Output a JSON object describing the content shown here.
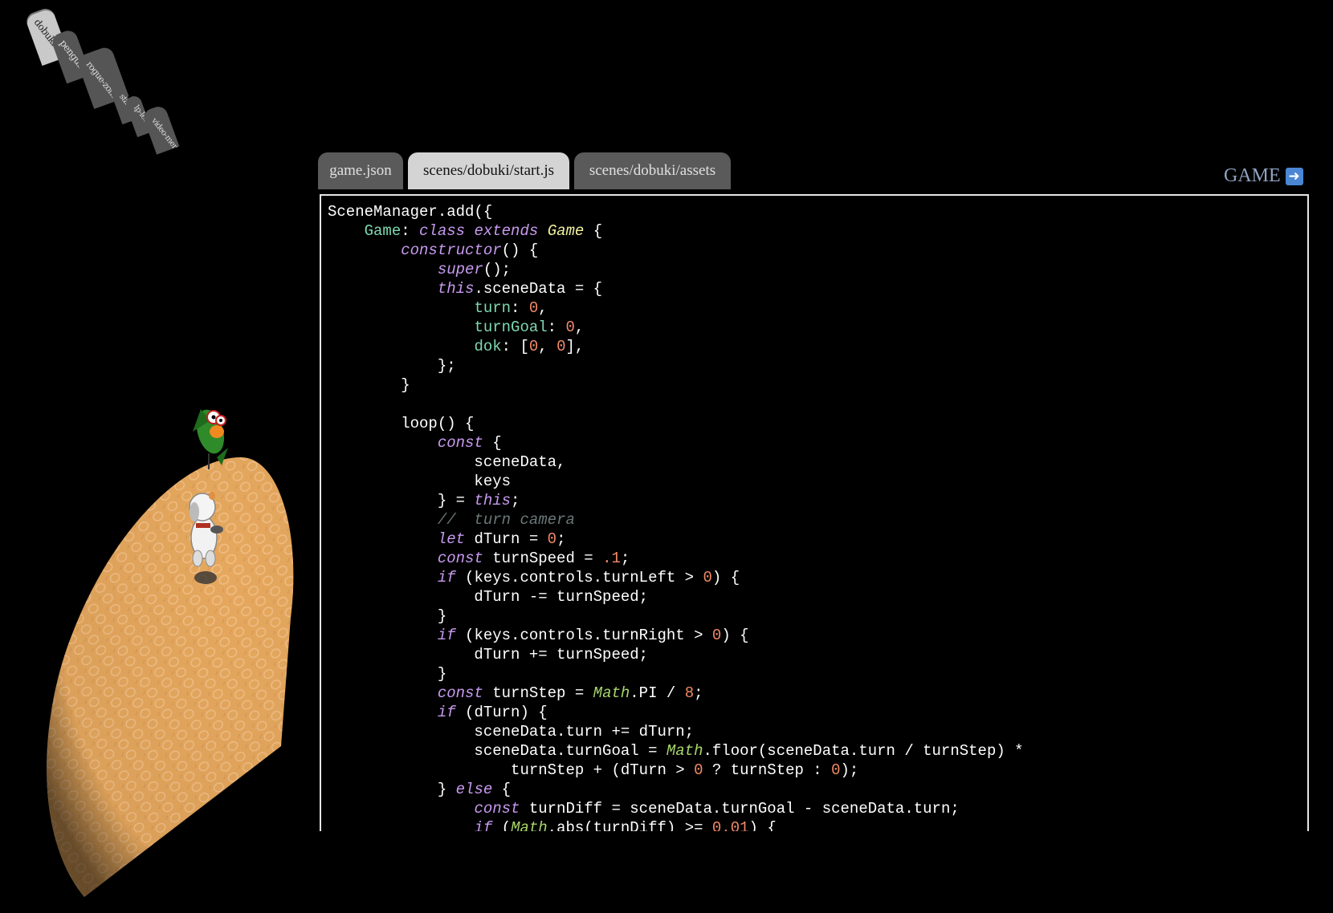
{
  "scene_tabs": [
    {
      "label": "dobuki",
      "active": true
    },
    {
      "label": "penguin",
      "active": false
    },
    {
      "label": "rogue-zombie",
      "active": false
    },
    {
      "label": "start",
      "active": false
    },
    {
      "label": "lp-lets",
      "active": false
    },
    {
      "label": "video-menu",
      "active": false
    }
  ],
  "file_tabs": [
    {
      "label": "game.json",
      "active": false
    },
    {
      "label": "scenes/dobuki/start.js",
      "active": true
    },
    {
      "label": "scenes/dobuki/assets",
      "active": false
    }
  ],
  "game_button": {
    "label": "GAME",
    "icon": "right-arrow-icon"
  },
  "colors": {
    "background": "#000000",
    "keyword": "#c89af0",
    "number": "#f08a68",
    "property": "#7ed8b0",
    "comment": "#6b7878",
    "math": "#a8d66a",
    "game_link": "#8fa3c0",
    "floor": "#e5a860"
  },
  "code_lines": [
    [
      [
        "pl",
        "SceneManager.add({"
      ]
    ],
    [
      [
        "pl",
        "    "
      ],
      [
        "prop",
        "Game"
      ],
      [
        "pl",
        ": "
      ],
      [
        "kw",
        "class"
      ],
      [
        "pl",
        " "
      ],
      [
        "kw",
        "extends"
      ],
      [
        "pl",
        " "
      ],
      [
        "game",
        "Game"
      ],
      [
        "pl",
        " {"
      ]
    ],
    [
      [
        "pl",
        "        "
      ],
      [
        "kw",
        "constructor"
      ],
      [
        "pl",
        "() {"
      ]
    ],
    [
      [
        "pl",
        "            "
      ],
      [
        "kw",
        "super"
      ],
      [
        "pl",
        "();"
      ]
    ],
    [
      [
        "pl",
        "            "
      ],
      [
        "kw",
        "this"
      ],
      [
        "pl",
        ".sceneData = {"
      ]
    ],
    [
      [
        "pl",
        "                "
      ],
      [
        "prop",
        "turn"
      ],
      [
        "pl",
        ": "
      ],
      [
        "num",
        "0"
      ],
      [
        "pl",
        ","
      ]
    ],
    [
      [
        "pl",
        "                "
      ],
      [
        "prop",
        "turnGoal"
      ],
      [
        "pl",
        ": "
      ],
      [
        "num",
        "0"
      ],
      [
        "pl",
        ","
      ]
    ],
    [
      [
        "pl",
        "                "
      ],
      [
        "prop",
        "dok"
      ],
      [
        "pl",
        ": ["
      ],
      [
        "num",
        "0"
      ],
      [
        "pl",
        ", "
      ],
      [
        "num",
        "0"
      ],
      [
        "pl",
        "],"
      ]
    ],
    [
      [
        "pl",
        "            };"
      ]
    ],
    [
      [
        "pl",
        "        }"
      ]
    ],
    [
      [
        "pl",
        ""
      ]
    ],
    [
      [
        "pl",
        "        loop() {"
      ]
    ],
    [
      [
        "pl",
        "            "
      ],
      [
        "kw",
        "const"
      ],
      [
        "pl",
        " {"
      ]
    ],
    [
      [
        "pl",
        "                sceneData,"
      ]
    ],
    [
      [
        "pl",
        "                keys"
      ]
    ],
    [
      [
        "pl",
        "            } = "
      ],
      [
        "kw",
        "this"
      ],
      [
        "pl",
        ";"
      ]
    ],
    [
      [
        "pl",
        "            "
      ],
      [
        "cmt",
        "//  turn camera"
      ]
    ],
    [
      [
        "pl",
        "            "
      ],
      [
        "kw",
        "let"
      ],
      [
        "pl",
        " dTurn = "
      ],
      [
        "num",
        "0"
      ],
      [
        "pl",
        ";"
      ]
    ],
    [
      [
        "pl",
        "            "
      ],
      [
        "kw",
        "const"
      ],
      [
        "pl",
        " turnSpeed = "
      ],
      [
        "num",
        ".1"
      ],
      [
        "pl",
        ";"
      ]
    ],
    [
      [
        "pl",
        "            "
      ],
      [
        "kw",
        "if"
      ],
      [
        "pl",
        " (keys.controls.turnLeft > "
      ],
      [
        "num",
        "0"
      ],
      [
        "pl",
        ") {"
      ]
    ],
    [
      [
        "pl",
        "                dTurn -= turnSpeed;"
      ]
    ],
    [
      [
        "pl",
        "            }"
      ]
    ],
    [
      [
        "pl",
        "            "
      ],
      [
        "kw",
        "if"
      ],
      [
        "pl",
        " (keys.controls.turnRight > "
      ],
      [
        "num",
        "0"
      ],
      [
        "pl",
        ") {"
      ]
    ],
    [
      [
        "pl",
        "                dTurn += turnSpeed;"
      ]
    ],
    [
      [
        "pl",
        "            }"
      ]
    ],
    [
      [
        "pl",
        "            "
      ],
      [
        "kw",
        "const"
      ],
      [
        "pl",
        " turnStep = "
      ],
      [
        "math",
        "Math"
      ],
      [
        "pl",
        ".PI / "
      ],
      [
        "num",
        "8"
      ],
      [
        "pl",
        ";"
      ]
    ],
    [
      [
        "pl",
        "            "
      ],
      [
        "kw",
        "if"
      ],
      [
        "pl",
        " (dTurn) {"
      ]
    ],
    [
      [
        "pl",
        "                sceneData.turn += dTurn;"
      ]
    ],
    [
      [
        "pl",
        "                sceneData.turnGoal = "
      ],
      [
        "math",
        "Math"
      ],
      [
        "pl",
        ".floor(sceneData.turn / turnStep) *"
      ]
    ],
    [
      [
        "pl",
        "                    turnStep + (dTurn > "
      ],
      [
        "num",
        "0"
      ],
      [
        "pl",
        " ? turnStep : "
      ],
      [
        "num",
        "0"
      ],
      [
        "pl",
        ");"
      ]
    ],
    [
      [
        "pl",
        "            } "
      ],
      [
        "kw",
        "else"
      ],
      [
        "pl",
        " {"
      ]
    ],
    [
      [
        "pl",
        "                "
      ],
      [
        "kw",
        "const"
      ],
      [
        "pl",
        " turnDiff = sceneData.turnGoal - sceneData.turn;"
      ]
    ],
    [
      [
        "pl",
        "                "
      ],
      [
        "kw",
        "if"
      ],
      [
        "pl",
        " ("
      ],
      [
        "math",
        "Math"
      ],
      [
        "pl",
        ".abs(turnDiff) >= "
      ],
      [
        "num",
        "0.01"
      ],
      [
        "pl",
        ") {"
      ]
    ]
  ]
}
